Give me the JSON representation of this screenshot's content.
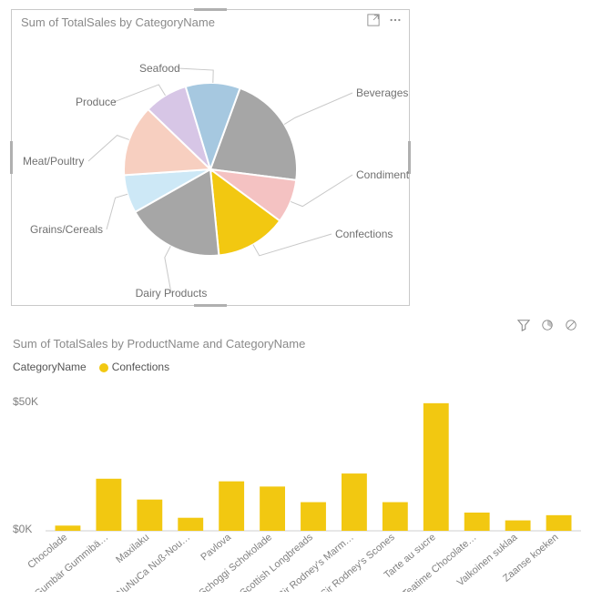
{
  "pie": {
    "title": "Sum of TotalSales by CategoryName",
    "labels": [
      "Beverages",
      "Condiments",
      "Confections",
      "Dairy Products",
      "Grains/Cereals",
      "Meat/Poultry",
      "Produce",
      "Seafood"
    ]
  },
  "bar": {
    "title": "Sum of TotalSales by ProductName and CategoryName",
    "legend_title": "CategoryName",
    "legend_item": "Confections",
    "y_max_label": "$50K",
    "y_min_label": "$0K",
    "categories": [
      "Chocolade",
      "Gumbär Gummibä…",
      "Maxilaku",
      "NuNuCa Nuß-Nou…",
      "Pavlova",
      "Schoggi Schokolade",
      "Scottish Longbreads",
      "Sir Rodney's Marm…",
      "Sir Rodney's Scones",
      "Tarte au sucre",
      "Teatime Chocolate…",
      "Valkoinen suklaa",
      "Zaanse koeken"
    ]
  },
  "chart_data": [
    {
      "type": "pie",
      "title": "Sum of TotalSales by CategoryName",
      "series": [
        {
          "name": "Beverages",
          "value": 21,
          "color": "#a6a6a6"
        },
        {
          "name": "Condiments",
          "value": 8,
          "color": "#f4c2c2"
        },
        {
          "name": "Confections",
          "value": 13,
          "color": "#f2c811"
        },
        {
          "name": "Dairy Products",
          "value": 18,
          "color": "#a6a6a6"
        },
        {
          "name": "Grains/Cereals",
          "value": 7,
          "color": "#cde8f6"
        },
        {
          "name": "Meat/Poultry",
          "value": 13,
          "color": "#f7cfc0"
        },
        {
          "name": "Produce",
          "value": 8,
          "color": "#d7c6e6"
        },
        {
          "name": "Seafood",
          "value": 10,
          "color": "#a6c8e0"
        }
      ]
    },
    {
      "type": "bar",
      "title": "Sum of TotalSales by ProductName and CategoryName",
      "xlabel": "",
      "ylabel": "",
      "ylim": [
        0,
        50
      ],
      "categories": [
        "Chocolade",
        "Gumbär Gummibä…",
        "Maxilaku",
        "NuNuCa Nuß-Nou…",
        "Pavlova",
        "Schoggi Schokolade",
        "Scottish Longbreads",
        "Sir Rodney's Marm…",
        "Sir Rodney's Scones",
        "Tarte au sucre",
        "Teatime Chocolate…",
        "Valkoinen suklaa",
        "Zaanse koeken"
      ],
      "series": [
        {
          "name": "Confections",
          "color": "#f2c811",
          "values": [
            2,
            20,
            12,
            5,
            19,
            17,
            11,
            22,
            11,
            49,
            7,
            4,
            6
          ]
        }
      ]
    }
  ]
}
